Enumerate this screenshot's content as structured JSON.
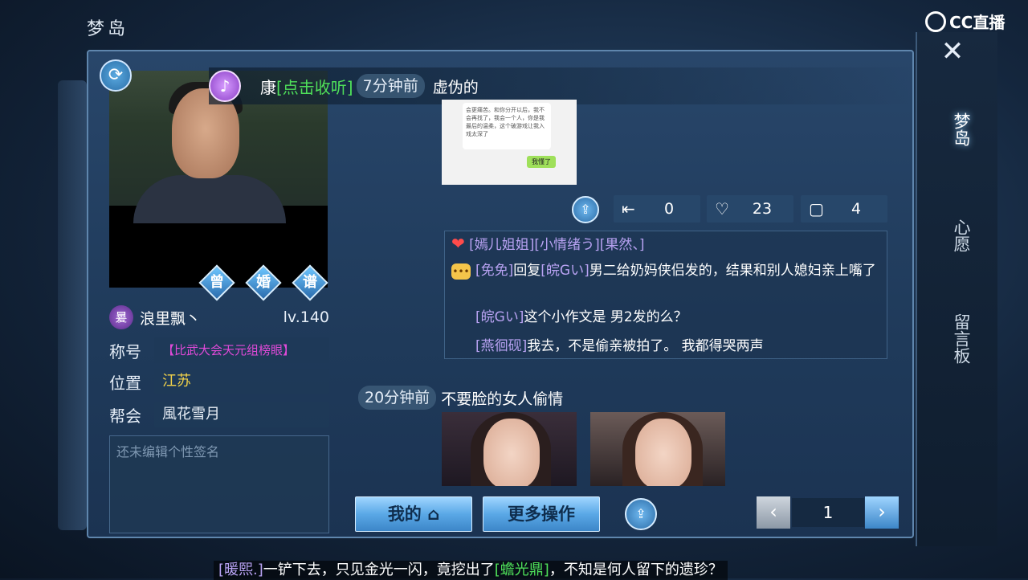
{
  "header": {
    "title": "梦岛",
    "brand": "CC直播"
  },
  "side_nav": {
    "items": [
      {
        "label": "梦岛",
        "active": true
      },
      {
        "label": "心愿",
        "active": false
      },
      {
        "label": "留言板",
        "active": false
      }
    ]
  },
  "profile": {
    "rhombus_buttons": [
      "曾",
      "婚",
      "谱"
    ],
    "avatar_glyph": "㬊",
    "name": "浪里飘丶",
    "level": "lv.140",
    "title_label": "称号",
    "title_value": "【比武大会天元组榜眼】",
    "location_label": "位置",
    "location_value": "江苏",
    "guild_label": "帮会",
    "guild_value": "風花雪月",
    "signature_placeholder": "还未编辑个性签名"
  },
  "music": {
    "song": "康",
    "link": "[点击收听]"
  },
  "post1": {
    "time": "7分钟前",
    "title": "虚伪的",
    "chat_text": "会更痛苦。和你分开以后，我不会再找了，我会一个人，你是我最后的温柔，这个破游戏让我入戏太深了",
    "chat_reply": "我懂了",
    "stats": {
      "forward": "0",
      "likes": "23",
      "comments": "4"
    },
    "likers": "[嫣儿姐姐][小情绪う][果然、]",
    "comments": [
      {
        "user": "[免免]",
        "verb": "回复",
        "target": "[皖Gい]",
        "text": "男二给奶妈侠侣发的，结果和别人媳妇亲上嘴了"
      },
      {
        "user": "[皖Gい]",
        "text": "这个小作文是 男2发的么？"
      },
      {
        "user": "[燕徊砚]",
        "text": "我去，不是偷亲被拍了。 我都得哭两声"
      }
    ]
  },
  "post2": {
    "time": "20分钟前",
    "title": "不要脸的女人偷情"
  },
  "bottom": {
    "my_label": "我的",
    "more_label": "更多操作",
    "page": "1"
  },
  "ticker": {
    "user": "[暖熙.]",
    "text1": "一铲下去，只见金光一闪，竟挖出了",
    "item": "[蟾光鼎]",
    "text2": "，不知是何人留下的遗珍？"
  },
  "icons": {
    "refresh": "refresh-icon",
    "music": "music-icon",
    "share": "share-icon",
    "forward": "forward-icon",
    "like": "heart-icon",
    "comment": "comment-icon",
    "close": "close-icon",
    "prev": "chevron-left-icon",
    "next": "chevron-right-icon",
    "home": "house-icon"
  },
  "colors": {
    "accent": "#5aa8e6",
    "username": "#b8a2f2",
    "highlight": "#4fe05a",
    "title_pink": "#e04ad8",
    "location_gold": "#f2d24a"
  }
}
